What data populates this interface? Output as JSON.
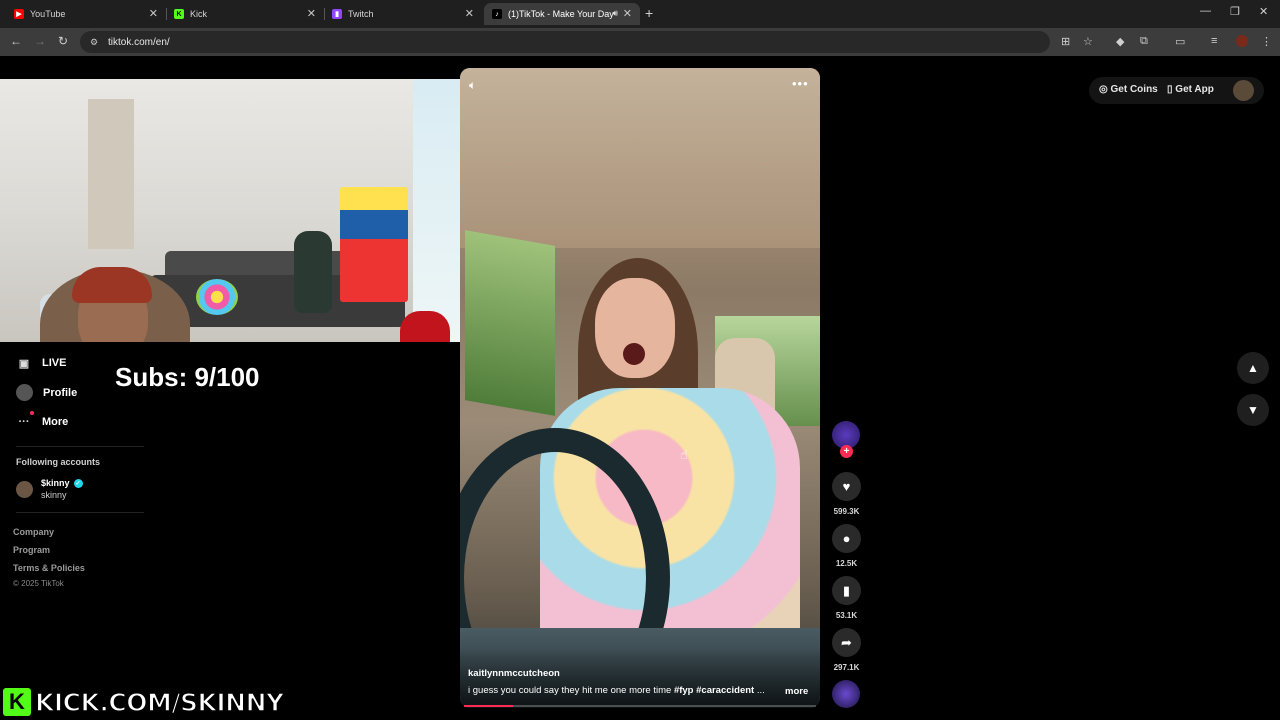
{
  "browser": {
    "tabs": [
      {
        "title": "YouTube",
        "favicon_color": "#ff0000"
      },
      {
        "title": "Kick",
        "favicon_color": "#53fc18"
      },
      {
        "title": "Twitch",
        "favicon_color": "#9146ff"
      },
      {
        "title": "(1)TikTok - Make Your Day",
        "favicon_color": "#ffffff",
        "active": true
      }
    ],
    "url": "tiktok.com/en/"
  },
  "overlay": {
    "subs_text": "Subs: 9/100",
    "kick_url": "KICK.COM/SKINNY",
    "kick_logo_letter": "K",
    "kick_color": "#53fc18"
  },
  "sidebar": {
    "nav": [
      {
        "label": "LIVE",
        "icon": "live-calendar-icon"
      },
      {
        "label": "Profile",
        "icon": "avatar"
      },
      {
        "label": "More",
        "icon": "more-dots-icon"
      }
    ],
    "following_title": "Following accounts",
    "following": [
      {
        "name": "$kinny",
        "handle": "skinny",
        "verified": true
      }
    ],
    "footer_links": [
      "Company",
      "Program",
      "Terms & Policies"
    ],
    "copyright": "© 2025 TikTok"
  },
  "video": {
    "author": "kaitlynnmccutcheon",
    "description": "i guess you could say they hit me one more time",
    "tags": [
      "#fyp",
      "#caraccident"
    ],
    "ellipsis": "...",
    "more_label": "more",
    "progress": 0.14
  },
  "actions": {
    "like_count": "599.3K",
    "comment_count": "12.5K",
    "save_count": "53.1K",
    "share_count": "297.1K",
    "accent": "#fe2c55"
  },
  "topbar": {
    "get_coins": "Get Coins",
    "get_app": "Get App"
  }
}
